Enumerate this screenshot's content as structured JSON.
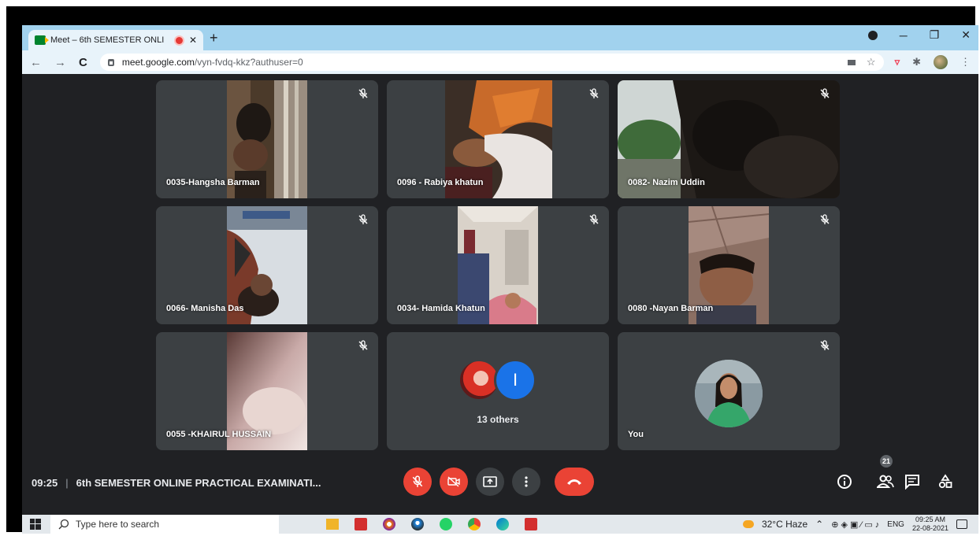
{
  "browser": {
    "tab_title": "Meet – 6th SEMESTER ONLI",
    "url_host": "meet.google.com",
    "url_path": "/vyn-fvdq-kkz?authuser=0"
  },
  "tiles": [
    {
      "name": "0035-Hangsha Barman",
      "muted": true
    },
    {
      "name": "0096 - Rabiya khatun",
      "muted": true
    },
    {
      "name": "0082- Nazim Uddin",
      "muted": true
    },
    {
      "name": "0066- Manisha Das",
      "muted": true
    },
    {
      "name": "0034- Hamida Khatun",
      "muted": true
    },
    {
      "name": "0080 -Nayan Barman",
      "muted": true
    },
    {
      "name": "0055 -KHAIRUL HUSSAIN",
      "muted": true
    }
  ],
  "others": {
    "label": "13 others",
    "initial": "I"
  },
  "self_tile": {
    "label": "You"
  },
  "meeting": {
    "time": "09:25",
    "separator": "|",
    "title": "6th SEMESTER ONLINE PRACTICAL EXAMINATI..."
  },
  "participants_count": "21",
  "taskbar": {
    "search_placeholder": "Type here to search",
    "weather": "32°C  Haze",
    "language": "ENG",
    "time": "09:25 AM",
    "date": "22-08-2021"
  },
  "colors": {
    "accent_red": "#ea4335",
    "tabstrip": "#a1d2ee",
    "meet_bg": "#202124",
    "tile_bg": "#3c4043"
  }
}
